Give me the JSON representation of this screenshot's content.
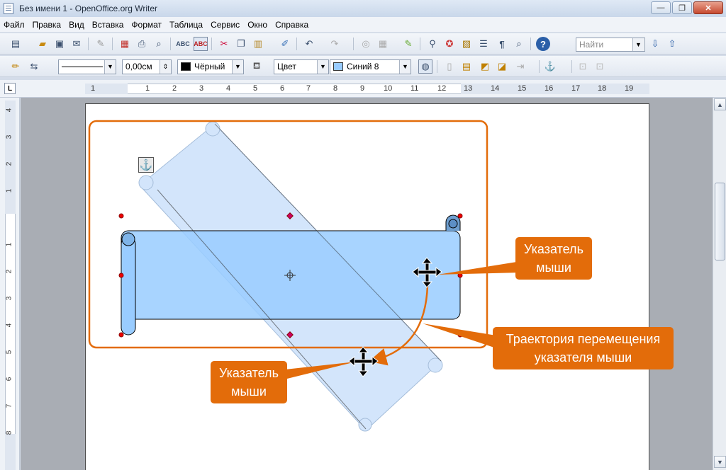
{
  "window": {
    "title": "Без имени 1 - OpenOffice.org Writer",
    "buttons": {
      "minimize": "—",
      "maximize": "❐",
      "close": "✕"
    }
  },
  "menu": [
    "Файл",
    "Правка",
    "Вид",
    "Вставка",
    "Формат",
    "Таблица",
    "Сервис",
    "Окно",
    "Справка"
  ],
  "toolbar_standard": {
    "icons": [
      "new-icon",
      "open-icon",
      "save-icon",
      "email-icon",
      "edit-file-icon",
      "export-pdf-icon",
      "print-icon",
      "print-preview-icon",
      "spellcheck-icon",
      "auto-spellcheck-icon",
      "cut-icon",
      "copy-icon",
      "paste-icon",
      "clone-format-icon",
      "undo-icon",
      "redo-icon",
      "hyperlink-icon",
      "table-icon",
      "draw-icon",
      "find-replace-icon",
      "navigator-icon",
      "gallery-icon",
      "data-sources-icon",
      "nonprinting-chars-icon",
      "zoom-icon",
      "help-icon"
    ],
    "find_placeholder": "Найти"
  },
  "toolbar_drawing": {
    "line_width": "0,00см",
    "line_color": "Чёрный",
    "line_color_hex": "#000000",
    "area_style": "Цвет",
    "area_color": "Синий 8",
    "area_color_hex": "#99ccff"
  },
  "ruler": {
    "horizontal": [
      "1",
      "1",
      "2",
      "3",
      "4",
      "5",
      "6",
      "7",
      "8",
      "9",
      "10",
      "11",
      "12",
      "13",
      "14",
      "15",
      "16",
      "17",
      "18",
      "19"
    ],
    "vertical": [
      "4",
      "3",
      "2",
      "1",
      "1",
      "2",
      "3",
      "4",
      "5",
      "6",
      "7",
      "8"
    ]
  },
  "annotations": {
    "pointer_top": "Указатель\nмыши",
    "trajectory": "Траектория  перемещения\nуказателя мыши",
    "pointer_bottom": "Указатель\nмыши",
    "callout_color": "#e36c0a"
  }
}
